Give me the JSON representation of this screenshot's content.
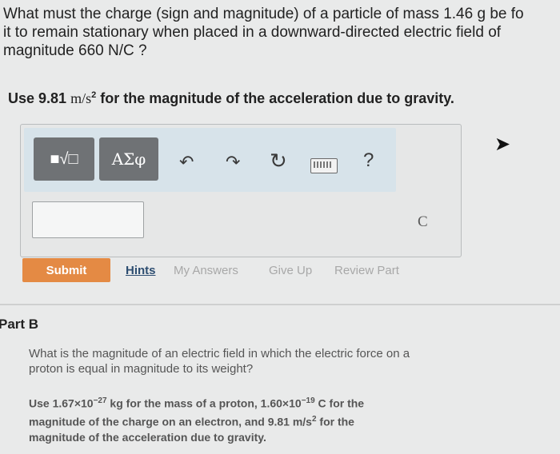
{
  "question": {
    "line1": "What must the charge (sign and magnitude) of a particle of mass 1.46 g be fo",
    "line2": "it to remain stationary when placed in a downward-directed electric field of",
    "line3": "magnitude 660 N/C ?"
  },
  "instruction": {
    "prefix": "Use 9.81 ",
    "unit_m": "m/s",
    "exponent": "2",
    "suffix": " for the magnitude of the acceleration due to gravity."
  },
  "toolbar": {
    "templates_label": "■√□",
    "greek_label": "ΑΣφ",
    "undo_glyph": "↶",
    "redo_glyph": "↷",
    "reset_glyph": "↻",
    "help_label": "?"
  },
  "answer": {
    "value": "",
    "unit": "C"
  },
  "actions": {
    "submit": "Submit",
    "hints": "Hints",
    "my_answers": "My Answers",
    "give_up": "Give Up",
    "review_part": "Review Part"
  },
  "part_b": {
    "title": "Part B",
    "question_line1": "What is the magnitude of an electric field in which the electric force on a",
    "question_line2": "proton is equal in magnitude to its weight?",
    "use_line1_a": "Use 1.67×10",
    "use_line1_exp1": "−27",
    "use_line1_b": " kg for the mass of a proton, 1.60×10",
    "use_line1_exp2": "−19",
    "use_line1_c": " C for the",
    "use_line2_a": "magnitude of the charge on an electron, and 9.81 m/s",
    "use_line2_exp": "2",
    "use_line2_b": " for the",
    "use_line3": "magnitude of the acceleration due to gravity."
  }
}
